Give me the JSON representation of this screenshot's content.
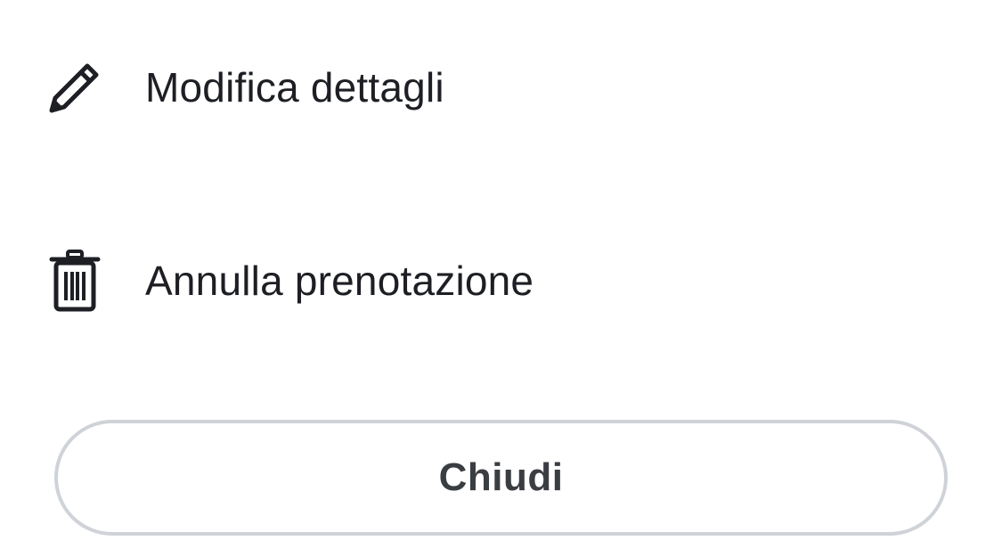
{
  "menu": {
    "items": [
      {
        "icon": "pencil-icon",
        "label": "Modifica dettagli"
      },
      {
        "icon": "trash-icon",
        "label": "Annulla prenotazione"
      }
    ]
  },
  "footer": {
    "close_label": "Chiudi"
  },
  "colors": {
    "text": "#1d1f24",
    "button_text": "#3a3d42",
    "button_border": "#cfd3d8",
    "background": "#ffffff"
  }
}
